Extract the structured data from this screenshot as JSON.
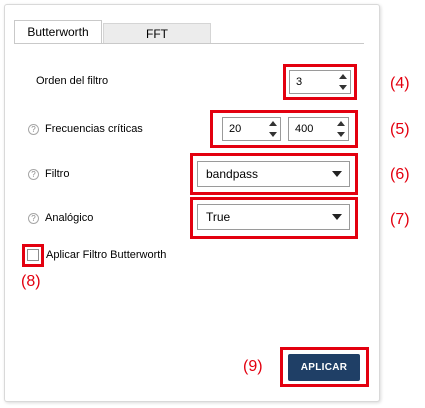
{
  "tabs": {
    "active": "Butterworth",
    "inactive": "FFT"
  },
  "fields": {
    "order": {
      "label": "Orden del filtro",
      "value": "3"
    },
    "critical": {
      "label": "Frecuencias críticas",
      "low": "20",
      "high": "400"
    },
    "filter": {
      "label": "Filtro",
      "value": "bandpass"
    },
    "analog": {
      "label": "Analógico",
      "value": "True"
    }
  },
  "checkbox": {
    "label": "Aplicar Filtro Butterworth",
    "checked": false
  },
  "button": {
    "label": "APLICAR"
  },
  "callouts": {
    "c4": "(4)",
    "c5": "(5)",
    "c6": "(6)",
    "c7": "(7)",
    "c8": "(8)",
    "c9": "(9)"
  },
  "help_glyph": "?",
  "colors": {
    "highlight": "#e3000f",
    "button_bg": "#1f3f66"
  }
}
